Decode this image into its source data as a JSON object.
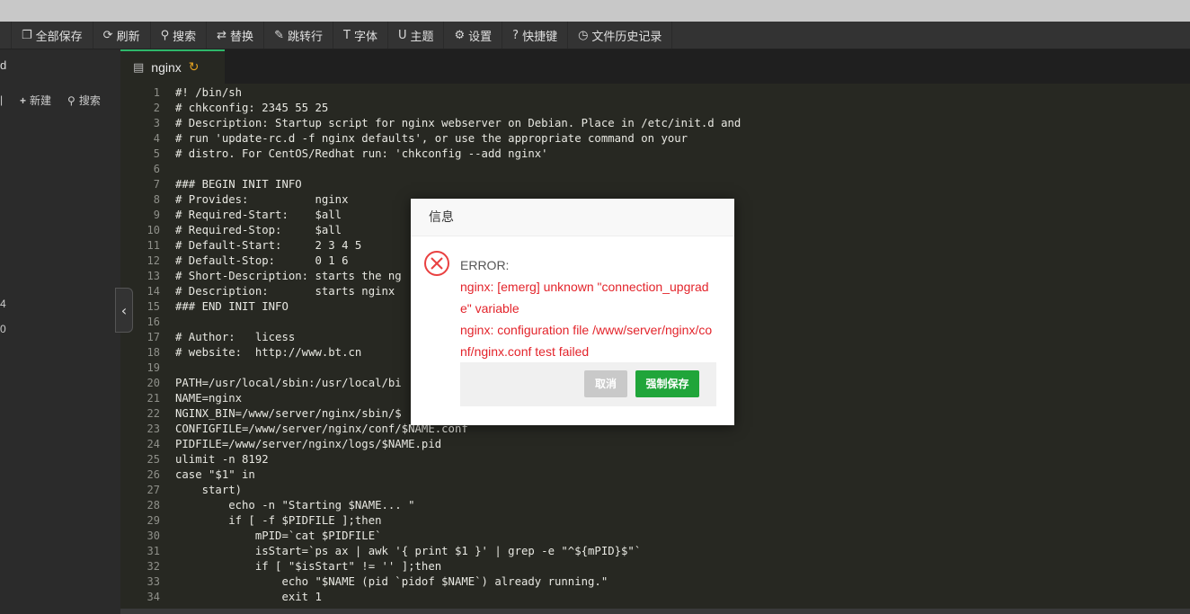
{
  "toolbar": {
    "items": [
      {
        "label": "全部保存",
        "icon": "copy-icon"
      },
      {
        "label": "刷新",
        "icon": "refresh-icon"
      },
      {
        "label": "搜索",
        "icon": "search-icon"
      },
      {
        "label": "替换",
        "icon": "replace-icon"
      },
      {
        "label": "跳转行",
        "icon": "pushpin-icon"
      },
      {
        "label": "字体",
        "icon": "text-icon"
      },
      {
        "label": "主题",
        "icon": "theme-icon"
      },
      {
        "label": "设置",
        "icon": "gear-icon"
      },
      {
        "label": "快捷键",
        "icon": "help-icon"
      },
      {
        "label": "文件历史记录",
        "icon": "history-icon"
      }
    ]
  },
  "sidebar": {
    "head_fragment": "d",
    "new_label": "新建",
    "search_label": "搜索",
    "num_fragment_1": "4",
    "num_fragment_2": "0"
  },
  "tab": {
    "filename": "nginx"
  },
  "editor": {
    "lines": [
      "#! /bin/sh",
      "# chkconfig: 2345 55 25",
      "# Description: Startup script for nginx webserver on Debian. Place in /etc/init.d and",
      "# run 'update-rc.d -f nginx defaults', or use the appropriate command on your",
      "# distro. For CentOS/Redhat run: 'chkconfig --add nginx'",
      "",
      "### BEGIN INIT INFO",
      "# Provides:          nginx",
      "# Required-Start:    $all",
      "# Required-Stop:     $all",
      "# Default-Start:     2 3 4 5",
      "# Default-Stop:      0 1 6",
      "# Short-Description: starts the ng",
      "# Description:       starts nginx",
      "### END INIT INFO",
      "",
      "# Author:   licess",
      "# website:  http://www.bt.cn",
      "",
      "PATH=/usr/local/sbin:/usr/local/bi",
      "NAME=nginx",
      "NGINX_BIN=/www/server/nginx/sbin/$",
      "CONFIGFILE=/www/server/nginx/conf/$NAME.conf",
      "PIDFILE=/www/server/nginx/logs/$NAME.pid",
      "ulimit -n 8192",
      "case \"$1\" in",
      "    start)",
      "        echo -n \"Starting $NAME... \"",
      "        if [ -f $PIDFILE ];then",
      "            mPID=`cat $PIDFILE`",
      "            isStart=`ps ax | awk '{ print $1 }' | grep -e \"^${mPID}$\"`",
      "            if [ \"$isStart\" != '' ];then",
      "                echo \"$NAME (pid `pidof $NAME`) already running.\"",
      "                exit 1"
    ]
  },
  "dialog": {
    "title": "信息",
    "label": "ERROR:",
    "messages": [
      "nginx: [emerg] unknown \"connection_upgrade\" variable",
      "nginx: configuration file /www/server/nginx/conf/nginx.conf test failed"
    ],
    "cancel_label": "取消",
    "force_save_label": "强制保存"
  }
}
